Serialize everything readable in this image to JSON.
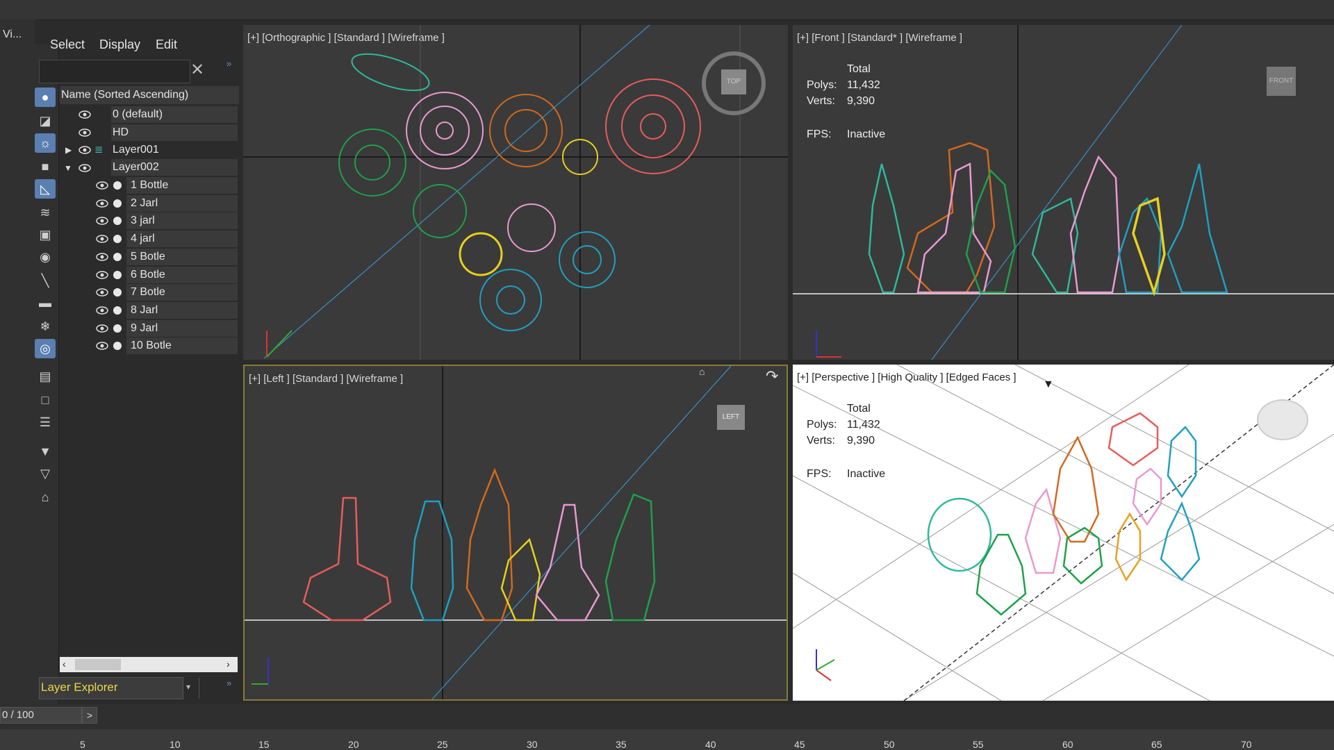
{
  "app": {
    "menu_stub": "Vi..."
  },
  "explorer": {
    "menus": [
      "Select",
      "Display",
      "Edit"
    ],
    "search_placeholder": "",
    "column_header": "Name (Sorted Ascending)",
    "layers": [
      {
        "name": "0 (default)",
        "expanded": null
      },
      {
        "name": "HD",
        "expanded": null
      },
      {
        "name": "Layer001",
        "expanded": false
      },
      {
        "name": "Layer002",
        "expanded": true
      }
    ],
    "objects": [
      "1 Bottle",
      "2 Jarl",
      "3 jarl",
      "4 jarl",
      "5 Botle",
      "6 Botle",
      "7 Botle",
      "8 Jarl",
      "9 Jarl",
      "10 Botle"
    ],
    "footer_dropdown": "Layer Explorer"
  },
  "viewports": {
    "top": {
      "label": "[+] [Orthographic ] [Standard ] [Wireframe ]",
      "nav_label": "TOP"
    },
    "front": {
      "label": "[+] [Front ] [Standard* ] [Wireframe ]",
      "nav_label": "FRONT",
      "stats": {
        "total_label": "Total",
        "polys_label": "Polys:",
        "polys": "11,432",
        "verts_label": "Verts:",
        "verts": "9,390",
        "fps_label": "FPS:",
        "fps": "Inactive"
      }
    },
    "left": {
      "label": "[+] [Left ] [Standard ] [Wireframe ]",
      "nav_label": "LEFT"
    },
    "perspective": {
      "label": "[+] [Perspective ] [High Quality ] [Edged Faces ]",
      "stats": {
        "total_label": "Total",
        "polys_label": "Polys:",
        "polys": "11,432",
        "verts_label": "Verts:",
        "verts": "9,390",
        "fps_label": "FPS:",
        "fps": "Inactive"
      }
    }
  },
  "timeline": {
    "frame": "0 / 100",
    "next": ">",
    "ticks": [
      "5",
      "10",
      "15",
      "20",
      "25",
      "30",
      "35",
      "40",
      "45",
      "50",
      "55",
      "60",
      "65",
      "70"
    ]
  },
  "colors": {
    "red": "#e85c5c",
    "pink": "#e89ad0",
    "orange": "#d2691e",
    "green": "#1ea04a",
    "cyan": "#1fa0c0",
    "yellow": "#e8d020",
    "teal": "#2fb89a"
  }
}
